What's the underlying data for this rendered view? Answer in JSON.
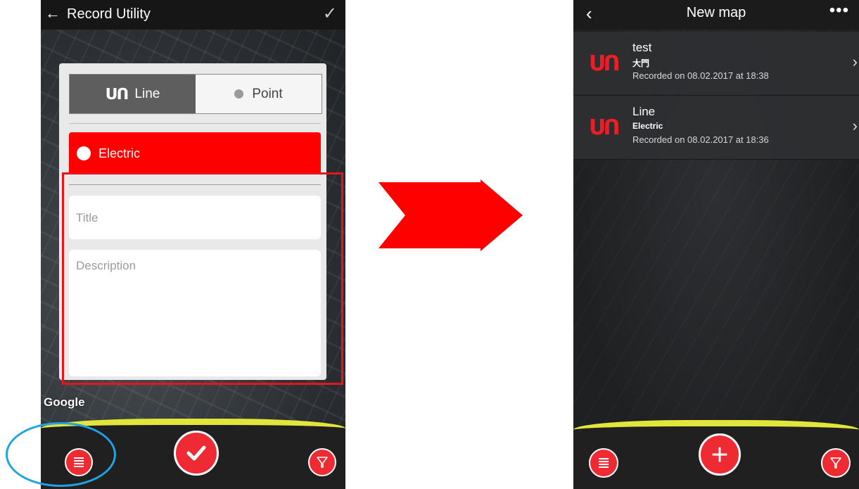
{
  "left_screen": {
    "header": {
      "back_icon": "arrow-left",
      "title": "Record Utility",
      "confirm_icon": "check"
    },
    "type_toggle": {
      "line_label": "Line",
      "point_label": "Point",
      "selected": "Line"
    },
    "category": {
      "label": "Electric",
      "color": "#ff0000"
    },
    "form": {
      "title_placeholder": "Title",
      "description_placeholder": "Description"
    },
    "map_attribution": "Google",
    "bottom_bar": {
      "left_icon": "list-icon",
      "center_icon": "check-icon",
      "right_icon": "filter-icon"
    },
    "highlight_colors": {
      "red_box": "#e8141b",
      "blue_ellipse": "#1ea4e6"
    }
  },
  "arrow": {
    "color": "#ff0000"
  },
  "right_screen": {
    "header": {
      "back_icon": "chevron-left",
      "title": "New map",
      "menu_icon": "more-dots"
    },
    "records": [
      {
        "name": "test",
        "category": "大門",
        "recorded": "Recorded on 08.02.2017 at 18:38"
      },
      {
        "name": "Line",
        "category": "Electric",
        "recorded": "Recorded on 08.02.2017 at 18:36"
      }
    ],
    "bottom_bar": {
      "left_icon": "list-icon",
      "center_icon": "plus-icon",
      "right_icon": "filter-icon"
    }
  },
  "colors": {
    "accent_red": "#ee2a33",
    "bar_yellow": "#e2e63a"
  }
}
